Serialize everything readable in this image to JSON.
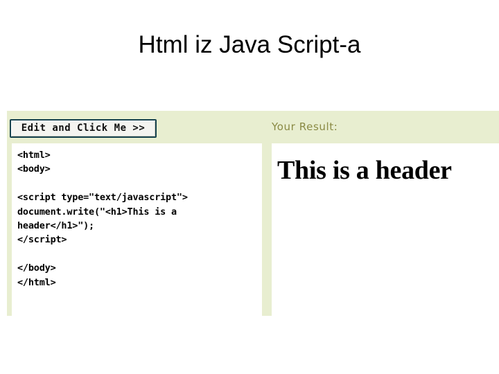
{
  "slide": {
    "title": "Html iz Java Script-a"
  },
  "tryit": {
    "run_button_label": "Edit and Click Me >>",
    "result_label": "Your Result:",
    "code": "<html>\n<body>\n\n<script type=\"text/javascript\">\ndocument.write(\"<h1>This is a\nheader</h1>\");\n</script>\n\n</body>\n</html>",
    "result_heading": "This is a header",
    "colors": {
      "panel_background": "#e8eed0",
      "pane_background": "#ffffff",
      "result_label_text": "#8a8a44",
      "button_border": "#17434f",
      "button_face": "#f4f4f0",
      "text": "#000000"
    }
  }
}
